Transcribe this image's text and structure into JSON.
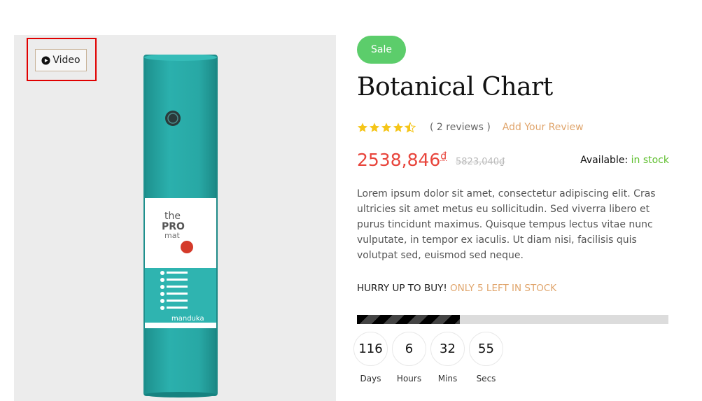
{
  "gallery": {
    "video_label": "Video"
  },
  "product": {
    "badge": "Sale",
    "title": "Botanical Chart",
    "rating_stars": 4.5,
    "reviews_text": "( 2 reviews )",
    "add_review": "Add Your Review",
    "price": "2538,846",
    "currency": "₫",
    "old_price": "5823,040₫",
    "availability_label": "Available: ",
    "availability_status": "in stock",
    "description": "Lorem ipsum dolor sit amet, consectetur adipiscing elit. Cras ultricies sit amet metus eu sollicitudin. Sed viverra libero et purus tincidunt maximus. Quisque tempus lectus vitae nunc vulputate, in tempor ex iaculis. Ut diam nisi, facilisis quis volutpat sed, euismod sed neque.",
    "hurry_text": "HURRY UP TO BUY! ",
    "hurry_highlight": "ONLY 5 LEFT IN STOCK",
    "stock_progress": 0.33
  },
  "countdown": [
    {
      "value": "116",
      "label": "Days"
    },
    {
      "value": "6",
      "label": "Hours"
    },
    {
      "value": "32",
      "label": "Mins"
    },
    {
      "value": "55",
      "label": "Secs"
    }
  ],
  "colors": {
    "sale_badge": "#5ccd6b",
    "price": "#e8453c",
    "accent": "#e0a56c",
    "in_stock": "#5fbf2f",
    "star": "#f5c518",
    "mat": "#28a8a5"
  },
  "icons": {
    "video": "play-circle-icon",
    "rating": "star-icon"
  },
  "mat_label": {
    "line1": "the",
    "line2": "PRO",
    "line3": "mat",
    "brand": "manduka"
  }
}
